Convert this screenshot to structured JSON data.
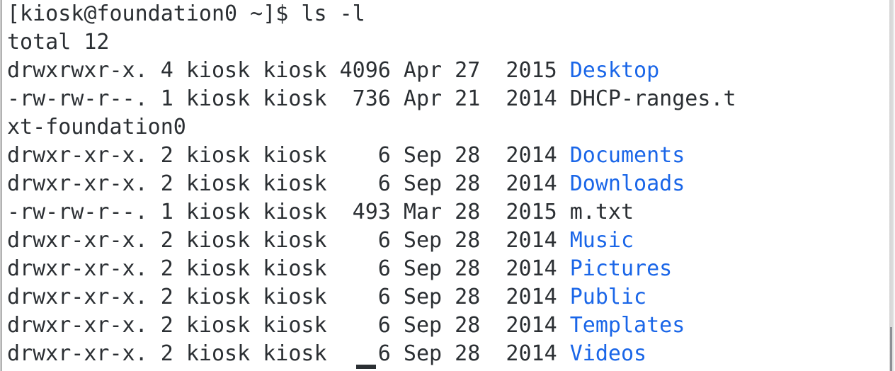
{
  "terminal": {
    "prompt_line": "[kiosk@foundation0 ~]$ ls -l",
    "total_line": "total 12",
    "colors": {
      "background": "#ffffff",
      "foreground": "#2b2f33",
      "directory": "#1a66e8",
      "border": "#9b9b9b",
      "scrollbar": "#8d9095"
    },
    "command": "ls -l",
    "user": "kiosk",
    "host": "foundation0",
    "cwd": "~",
    "total_blocks": "12",
    "lines": [
      {
        "id": "line-prompt",
        "kind": "prompt",
        "segments": [
          {
            "text": "[kiosk@foundation0 ~]$ ls -l",
            "color": "plain"
          }
        ]
      },
      {
        "id": "line-total",
        "kind": "total",
        "segments": [
          {
            "text": "total 12",
            "color": "plain"
          }
        ]
      },
      {
        "id": "line-desktop",
        "kind": "entry",
        "permissions": "drwxrwxr-x.",
        "links": "4",
        "owner": "kiosk",
        "group": "kiosk",
        "size": "4096",
        "month": "Apr",
        "day": "27",
        "year": "2015",
        "name": "Desktop",
        "type": "directory",
        "segments": [
          {
            "text": "drwxrwxr-x. 4 kiosk kiosk 4096 Apr 27  2015 ",
            "color": "plain"
          },
          {
            "text": "Desktop",
            "color": "dir"
          }
        ]
      },
      {
        "id": "line-dhcp-ranges",
        "kind": "entry",
        "permissions": "-rw-rw-r--.",
        "links": "1",
        "owner": "kiosk",
        "group": "kiosk",
        "size": "736",
        "month": "Apr",
        "day": "21",
        "year": "2014",
        "name": "DHCP-ranges.txt-foundation0",
        "type": "file",
        "segments": [
          {
            "text": "-rw-rw-r--. 1 kiosk kiosk  736 Apr 21  2014 DHCP-ranges.t",
            "color": "plain"
          }
        ]
      },
      {
        "id": "line-dhcp-wrap",
        "kind": "wrap",
        "segments": [
          {
            "text": "xt-foundation0",
            "color": "plain"
          }
        ]
      },
      {
        "id": "line-documents",
        "kind": "entry",
        "permissions": "drwxr-xr-x.",
        "links": "2",
        "owner": "kiosk",
        "group": "kiosk",
        "size": "6",
        "month": "Sep",
        "day": "28",
        "year": "2014",
        "name": "Documents",
        "type": "directory",
        "segments": [
          {
            "text": "drwxr-xr-x. 2 kiosk kiosk    6 Sep 28  2014 ",
            "color": "plain"
          },
          {
            "text": "Documents",
            "color": "dir"
          }
        ]
      },
      {
        "id": "line-downloads",
        "kind": "entry",
        "permissions": "drwxr-xr-x.",
        "links": "2",
        "owner": "kiosk",
        "group": "kiosk",
        "size": "6",
        "month": "Sep",
        "day": "28",
        "year": "2014",
        "name": "Downloads",
        "type": "directory",
        "segments": [
          {
            "text": "drwxr-xr-x. 2 kiosk kiosk    6 Sep 28  2014 ",
            "color": "plain"
          },
          {
            "text": "Downloads",
            "color": "dir"
          }
        ]
      },
      {
        "id": "line-mtxt",
        "kind": "entry",
        "permissions": "-rw-rw-r--.",
        "links": "1",
        "owner": "kiosk",
        "group": "kiosk",
        "size": "493",
        "month": "Mar",
        "day": "28",
        "year": "2015",
        "name": "m.txt",
        "type": "file",
        "segments": [
          {
            "text": "-rw-rw-r--. 1 kiosk kiosk  493 Mar 28  2015 m.txt",
            "color": "plain"
          }
        ]
      },
      {
        "id": "line-music",
        "kind": "entry",
        "permissions": "drwxr-xr-x.",
        "links": "2",
        "owner": "kiosk",
        "group": "kiosk",
        "size": "6",
        "month": "Sep",
        "day": "28",
        "year": "2014",
        "name": "Music",
        "type": "directory",
        "segments": [
          {
            "text": "drwxr-xr-x. 2 kiosk kiosk    6 Sep 28  2014 ",
            "color": "plain"
          },
          {
            "text": "Music",
            "color": "dir"
          }
        ]
      },
      {
        "id": "line-pictures",
        "kind": "entry",
        "permissions": "drwxr-xr-x.",
        "links": "2",
        "owner": "kiosk",
        "group": "kiosk",
        "size": "6",
        "month": "Sep",
        "day": "28",
        "year": "2014",
        "name": "Pictures",
        "type": "directory",
        "segments": [
          {
            "text": "drwxr-xr-x. 2 kiosk kiosk    6 Sep 28  2014 ",
            "color": "plain"
          },
          {
            "text": "Pictures",
            "color": "dir"
          }
        ]
      },
      {
        "id": "line-public",
        "kind": "entry",
        "permissions": "drwxr-xr-x.",
        "links": "2",
        "owner": "kiosk",
        "group": "kiosk",
        "size": "6",
        "month": "Sep",
        "day": "28",
        "year": "2014",
        "name": "Public",
        "type": "directory",
        "segments": [
          {
            "text": "drwxr-xr-x. 2 kiosk kiosk    6 Sep 28  2014 ",
            "color": "plain"
          },
          {
            "text": "Public",
            "color": "dir"
          }
        ]
      },
      {
        "id": "line-templates",
        "kind": "entry",
        "permissions": "drwxr-xr-x.",
        "links": "2",
        "owner": "kiosk",
        "group": "kiosk",
        "size": "6",
        "month": "Sep",
        "day": "28",
        "year": "2014",
        "name": "Templates",
        "type": "directory",
        "segments": [
          {
            "text": "drwxr-xr-x. 2 kiosk kiosk    6 Sep 28  2014 ",
            "color": "plain"
          },
          {
            "text": "Templates",
            "color": "dir"
          }
        ]
      },
      {
        "id": "line-videos",
        "kind": "entry",
        "permissions": "drwxr-xr-x.",
        "links": "2",
        "owner": "kiosk",
        "group": "kiosk",
        "size": "6",
        "month": "Sep",
        "day": "28",
        "year": "2014",
        "name": "Videos",
        "type": "directory",
        "segments": [
          {
            "text": "drwxr-xr-x. 2 kiosk kiosk    6 Sep 28  2014 ",
            "color": "plain"
          },
          {
            "text": "Videos",
            "color": "dir"
          }
        ]
      }
    ]
  }
}
